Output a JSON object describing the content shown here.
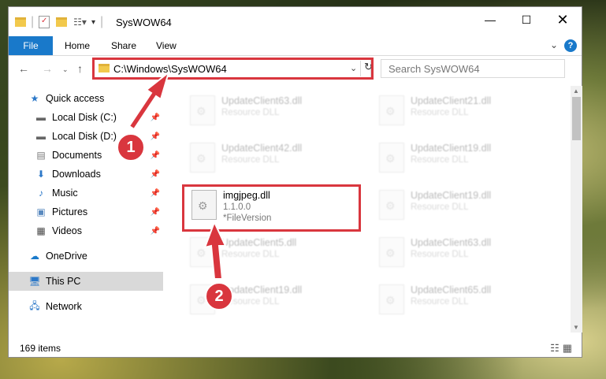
{
  "window": {
    "title": "SysWOW64"
  },
  "ribbon": {
    "tabs": [
      "File",
      "Home",
      "Share",
      "View"
    ]
  },
  "nav": {
    "address_path": "C:\\Windows\\SysWOW64",
    "search_placeholder": "Search SysWOW64"
  },
  "sidebar": {
    "items": [
      {
        "label": "Quick access",
        "icon": "star-icon"
      },
      {
        "label": "Local Disk (C:)",
        "icon": "drive-icon",
        "pinned": true
      },
      {
        "label": "Local Disk (D:)",
        "icon": "drive-icon",
        "pinned": true
      },
      {
        "label": "Documents",
        "icon": "documents-icon",
        "pinned": true
      },
      {
        "label": "Downloads",
        "icon": "download-icon",
        "pinned": true
      },
      {
        "label": "Music",
        "icon": "music-icon",
        "pinned": true
      },
      {
        "label": "Pictures",
        "icon": "pictures-icon",
        "pinned": true
      },
      {
        "label": "Videos",
        "icon": "videos-icon",
        "pinned": true
      },
      {
        "label": "OneDrive",
        "icon": "cloud-icon"
      },
      {
        "label": "This PC",
        "icon": "computer-icon",
        "selected": true
      },
      {
        "label": "Network",
        "icon": "network-icon"
      }
    ]
  },
  "files": [
    {
      "name": "UpdateClient63.dll",
      "type": "Resource DLL"
    },
    {
      "name": "UpdateClient21.dll",
      "type": "Resource DLL"
    },
    {
      "name": "UpdateClient42.dll",
      "type": "Resource DLL"
    },
    {
      "name": "UpdateClient19.dll",
      "type": "Resource DLL"
    },
    {
      "name": "imgjpeg.dll",
      "version": "1.1.0.0",
      "type": "*FileVersion",
      "highlighted": true
    },
    {
      "name": "UpdateClient19.dll",
      "type": "Resource DLL"
    },
    {
      "name": "UpdateClient5.dll",
      "type": "Resource DLL"
    },
    {
      "name": "UpdateClient63.dll",
      "type": "Resource DLL"
    },
    {
      "name": "UpdateClient19.dll",
      "type": "Resource DLL"
    },
    {
      "name": "UpdateClient65.dll",
      "type": "Resource DLL"
    }
  ],
  "status": {
    "item_count": "169 items"
  },
  "annotations": {
    "step1": "1",
    "step2": "2"
  },
  "colors": {
    "accent": "#1979ca",
    "annotation": "#d9363e"
  }
}
